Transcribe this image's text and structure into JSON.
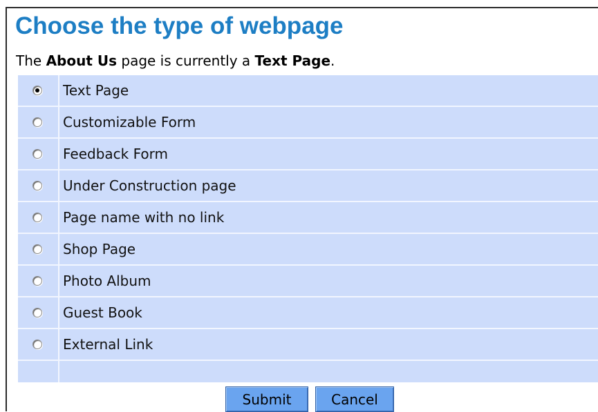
{
  "heading": "Choose the type of webpage",
  "status": {
    "prefix": "The ",
    "page_name": "About Us",
    "middle": " page is currently a ",
    "page_type": "Text Page",
    "suffix": "."
  },
  "options": [
    {
      "label": "Text Page",
      "checked": true
    },
    {
      "label": "Customizable Form",
      "checked": false
    },
    {
      "label": "Feedback Form",
      "checked": false
    },
    {
      "label": "Under Construction page",
      "checked": false
    },
    {
      "label": "Page name with no link",
      "checked": false
    },
    {
      "label": "Shop Page",
      "checked": false
    },
    {
      "label": "Photo Album",
      "checked": false
    },
    {
      "label": "Guest Book",
      "checked": false
    },
    {
      "label": "External Link",
      "checked": false
    }
  ],
  "buttons": {
    "submit_label": "Submit",
    "cancel_label": "Cancel"
  },
  "colors": {
    "heading": "#1d7ec4",
    "option_background": "#cddcfb",
    "button_background": "#6aa4ef"
  }
}
